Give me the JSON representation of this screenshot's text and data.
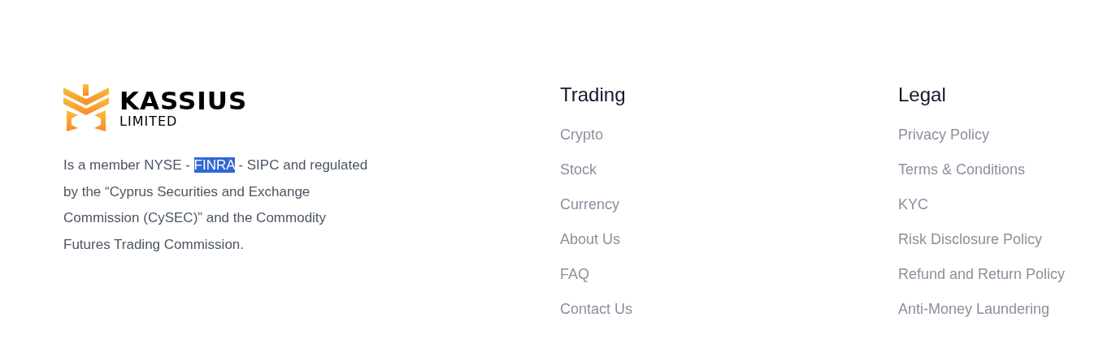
{
  "brand": {
    "name": "KASSIUS",
    "subtitle": "LIMITED"
  },
  "description": [
    {
      "text": "Is a member NYSE - ",
      "selected": false
    },
    {
      "text": "FINRA",
      "selected": true
    },
    {
      "text": " - SIPC and regulated by the “Cyprus Securities and Exchange Commission (CySEC)” and the Commodity Futures Trading Commission.",
      "selected": false
    }
  ],
  "columns": [
    {
      "title": "Trading",
      "links": [
        "Crypto",
        "Stock",
        "Currency",
        "About Us",
        "FAQ",
        "Contact Us"
      ]
    },
    {
      "title": "Legal",
      "links": [
        "Privacy Policy",
        "Terms & Conditions",
        "KYC",
        "Risk Disclosure Policy",
        "Refund and Return Policy",
        "Anti-Money Laundering"
      ]
    }
  ]
}
